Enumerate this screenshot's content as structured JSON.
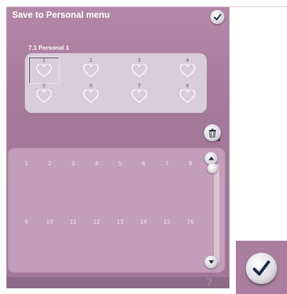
{
  "window": {
    "title": "Save to Personal menu"
  },
  "personal_menu": {
    "label": "7.1 Personal 1",
    "slots": [
      "1",
      "2",
      "3",
      "4",
      "5",
      "6",
      "7",
      "8"
    ],
    "selected_slot": "1"
  },
  "stitch_cells": [
    "1",
    "2",
    "3",
    "4",
    "5",
    "6",
    "7",
    "8",
    "9",
    "10",
    "11",
    "12",
    "13",
    "14",
    "15",
    "16"
  ],
  "help": {
    "glyph": "?"
  },
  "icons": {
    "ok_small": "checkmark-icon",
    "ok_big": "checkmark-icon",
    "delete": "trash-icon",
    "slot": "heart-icon",
    "scroll_up": "arrow-up-icon",
    "scroll_down": "arrow-down-icon"
  },
  "colors": {
    "panel": "#a47898",
    "personal_box": "#d9cdd9",
    "stitch_area": "#c39dba",
    "bottom_bar": "#8f6a88",
    "checkmark": "#1f2a4a"
  }
}
